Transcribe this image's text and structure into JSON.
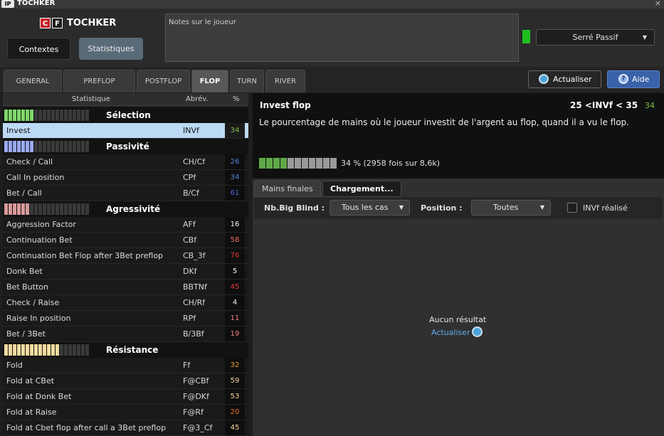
{
  "window": {
    "title": "TOCHKER",
    "icon_text": "IP",
    "close": "×"
  },
  "header": {
    "logo_c": "C",
    "logo_f": "F",
    "logo_name": "TOCHKER",
    "contextes_label": "Contextes",
    "statistiques_label": "Statistiques",
    "notes_placeholder": "Notes sur le joueur",
    "status_color": "#1fbf1f",
    "profile_value": "Serré Passif"
  },
  "tabs": [
    {
      "label": "GENERAL"
    },
    {
      "label": "PREFLOP"
    },
    {
      "label": "POSTFLOP"
    },
    {
      "label": "FLOP",
      "active": true
    },
    {
      "label": "TURN"
    },
    {
      "label": "RIVER"
    }
  ],
  "actions": {
    "refresh_label": "Actualiser",
    "help_label": "Aide",
    "help_icon": "?"
  },
  "stats_table": {
    "headers": {
      "stat": "Statistique",
      "abbr": "Abrév.",
      "pct": "%"
    },
    "sections": {
      "selection": "Sélection",
      "passivite": "Passivité",
      "agressivite": "Agressivité",
      "resistance": "Résistance"
    },
    "section_colors": {
      "selection": "#7fd86a",
      "passivite": "#9aaaf2",
      "agressivite": "#d99a9a",
      "resistance": "#f3dca0"
    },
    "section_bar_fill": {
      "selection": 7,
      "passivite": 7,
      "agressivite": 6,
      "resistance": 13
    },
    "rows": {
      "invest": {
        "name": "Invest",
        "abbr": "INVf",
        "value": "34",
        "color": "#7cc04a"
      },
      "check_call": {
        "name": "Check / Call",
        "abbr": "CH/Cf",
        "value": "26",
        "color": "#4f87e8"
      },
      "call_in_position": {
        "name": "Call In position",
        "abbr": "CPf",
        "value": "34",
        "color": "#4f87e8"
      },
      "bet_call": {
        "name": "Bet / Call",
        "abbr": "B/Cf",
        "value": "61",
        "color": "#4f67d8"
      },
      "aggression_factor": {
        "name": "Aggression Factor",
        "abbr": "AFf",
        "value": "16",
        "color": "#f5f5f5"
      },
      "continuation_bet": {
        "name": "Continuation Bet",
        "abbr": "CBf",
        "value": "58",
        "color": "#f07060"
      },
      "cbet_after_3bet": {
        "name": "Continuation Bet Flop after 3Bet preflop",
        "abbr": "CB_3f",
        "value": "76",
        "color": "#e23a3a"
      },
      "donk_bet": {
        "name": "Donk Bet",
        "abbr": "DKf",
        "value": "5",
        "color": "#f5f5f5"
      },
      "bet_button": {
        "name": "Bet Button",
        "abbr": "BBTNf",
        "value": "45",
        "color": "#e23a3a"
      },
      "check_raise": {
        "name": "Check / Raise",
        "abbr": "CH/Rf",
        "value": "4",
        "color": "#f5f5f5"
      },
      "raise_in_position": {
        "name": "Raise In position",
        "abbr": "RPf",
        "value": "11",
        "color": "#f08080"
      },
      "bet_3bet": {
        "name": "Bet / 3Bet",
        "abbr": "B/3Bf",
        "value": "19",
        "color": "#f08080"
      },
      "fold": {
        "name": "Fold",
        "abbr": "Ff",
        "value": "32",
        "color": "#f0a030"
      },
      "fold_cbet": {
        "name": "Fold at CBet",
        "abbr": "F@CBf",
        "value": "59",
        "color": "#f5d29a"
      },
      "fold_donk": {
        "name": "Fold at Donk Bet",
        "abbr": "F@DKf",
        "value": "53",
        "color": "#f5d29a"
      },
      "fold_raise": {
        "name": "Fold at Raise",
        "abbr": "F@Rf",
        "value": "20",
        "color": "#f07020"
      },
      "fold_cbet_3bet": {
        "name": "Fold at Cbet flop after call a 3Bet preflop",
        "abbr": "F@3_Cf",
        "value": "45",
        "color": "#f5d29a"
      }
    }
  },
  "detail": {
    "title": "Invest flop",
    "range": "25 <INVf < 35",
    "value": "34",
    "description": "Le pourcentage de mains où le joueur investit de l'argent au flop, quand il a vu le flop.",
    "progress_fraction": 0.34,
    "progress_text": "34 % (2958 fois sur 8,6k)"
  },
  "subtabs": [
    {
      "label": "Mains finales"
    },
    {
      "label": "Chargement...",
      "active": true
    }
  ],
  "filters": {
    "bb_label": "Nb.Big Blind :",
    "bb_value": "Tous les cas",
    "position_label": "Position :",
    "position_value": "Toutes",
    "invf_label": "INVf réalisé",
    "invf_checked": false
  },
  "results": {
    "empty_text": "Aucun résultat",
    "refresh_link": "Actualiser"
  }
}
